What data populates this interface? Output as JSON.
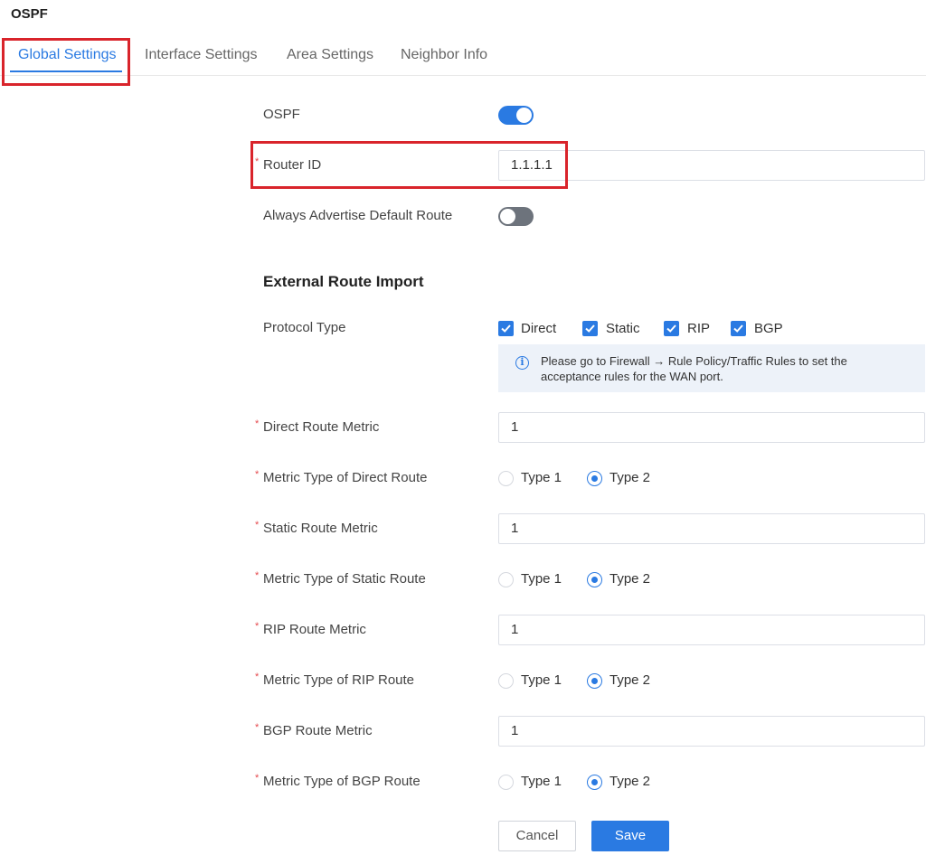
{
  "page_title": "OSPF",
  "tabs": [
    {
      "label": "Global Settings",
      "active": true
    },
    {
      "label": "Interface Settings",
      "active": false
    },
    {
      "label": "Area Settings",
      "active": false
    },
    {
      "label": "Neighbor Info",
      "active": false
    }
  ],
  "form": {
    "ospf": {
      "label": "OSPF",
      "enabled": true
    },
    "router_id": {
      "label": "Router ID",
      "required": true,
      "value": "1.1.1.1"
    },
    "always_advertise": {
      "label": "Always Advertise Default Route",
      "enabled": false
    }
  },
  "external_route_import": {
    "title": "External Route Import",
    "protocol_type": {
      "label": "Protocol Type",
      "options": [
        {
          "label": "Direct",
          "checked": true
        },
        {
          "label": "Static",
          "checked": true
        },
        {
          "label": "RIP",
          "checked": true
        },
        {
          "label": "BGP",
          "checked": true
        }
      ]
    },
    "notice": "Please go to Firewall → Rule Policy/Traffic Rules to set the acceptance rules for the WAN port.",
    "metrics": [
      {
        "label": "Direct Route Metric",
        "value": "1"
      },
      {
        "label": "Static Route Metric",
        "value": "1"
      },
      {
        "label": "RIP Route Metric",
        "value": "1"
      },
      {
        "label": "BGP Route Metric",
        "value": "1"
      }
    ],
    "metric_types": [
      {
        "label": "Metric Type of Direct Route",
        "option1": "Type 1",
        "option2": "Type 2",
        "selected": "Type 2"
      },
      {
        "label": "Metric Type of Static Route",
        "option1": "Type 1",
        "option2": "Type 2",
        "selected": "Type 2"
      },
      {
        "label": "Metric Type of RIP Route",
        "option1": "Type 1",
        "option2": "Type 2",
        "selected": "Type 2"
      },
      {
        "label": "Metric Type of BGP Route",
        "option1": "Type 1",
        "option2": "Type 2",
        "selected": "Type 2"
      }
    ],
    "required_mark": "*"
  },
  "buttons": {
    "cancel": "Cancel",
    "save": "Save"
  },
  "colors": {
    "accent": "#2a7ae2",
    "highlight": "#d9242b",
    "required": "#e5484d"
  }
}
